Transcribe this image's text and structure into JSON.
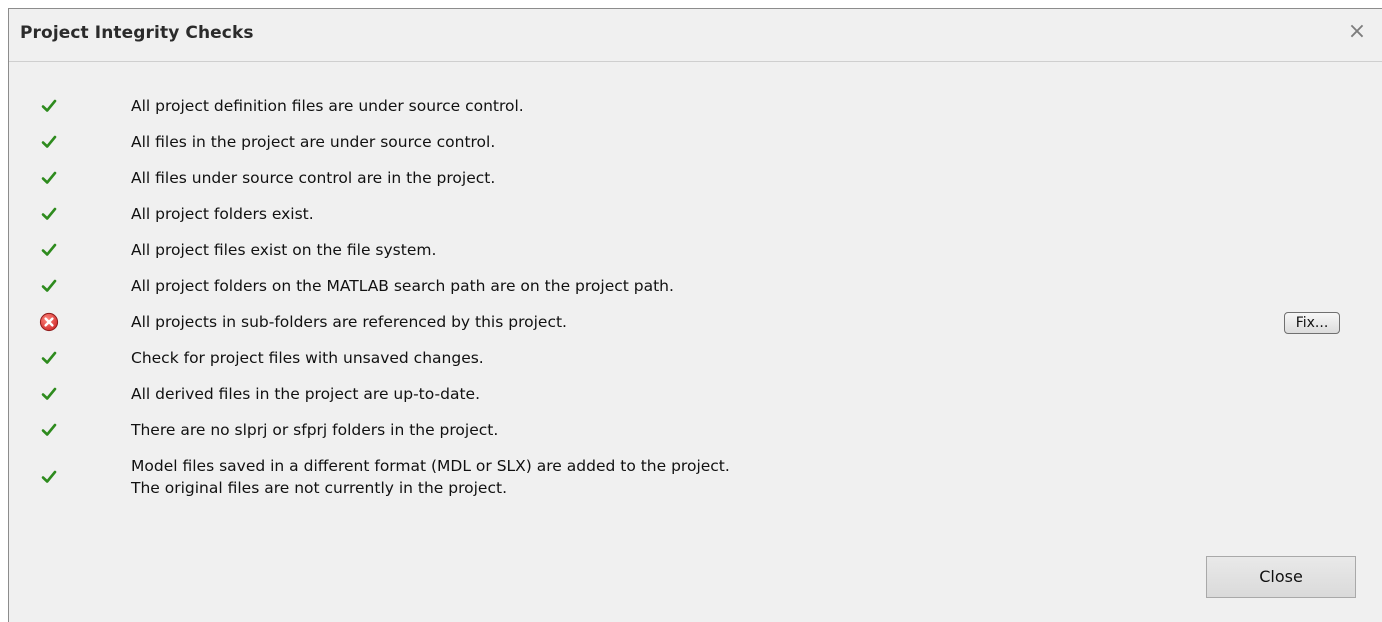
{
  "dialog": {
    "title": "Project Integrity Checks",
    "close_icon": "×",
    "close_label": "Close",
    "fix_label": "Fix..."
  },
  "colors": {
    "pass": "#2e8b1e",
    "fail": "#d32f2f"
  },
  "checks": [
    {
      "status": "pass",
      "icon": "check-icon",
      "lines": [
        "All project definition files are under source control."
      ]
    },
    {
      "status": "pass",
      "icon": "check-icon",
      "lines": [
        "All files in the project are under source control."
      ]
    },
    {
      "status": "pass",
      "icon": "check-icon",
      "lines": [
        "All files under source control are in the project."
      ]
    },
    {
      "status": "pass",
      "icon": "check-icon",
      "lines": [
        "All project folders exist."
      ]
    },
    {
      "status": "pass",
      "icon": "check-icon",
      "lines": [
        "All project files exist on the file system."
      ]
    },
    {
      "status": "pass",
      "icon": "check-icon",
      "lines": [
        "All project folders on the MATLAB search path are on the project path."
      ]
    },
    {
      "status": "fail",
      "icon": "error-icon",
      "lines": [
        "All projects in sub-folders are referenced by this project."
      ],
      "has_fix": true
    },
    {
      "status": "pass",
      "icon": "check-icon",
      "lines": [
        "Check for project files with unsaved changes."
      ]
    },
    {
      "status": "pass",
      "icon": "check-icon",
      "lines": [
        "All derived files in the project are up-to-date."
      ]
    },
    {
      "status": "pass",
      "icon": "check-icon",
      "lines": [
        "There are no slprj or sfprj folders in the project."
      ]
    },
    {
      "status": "pass",
      "icon": "check-icon",
      "lines": [
        "Model files saved in a different format (MDL or SLX) are added to the project.",
        "The original files are not currently in the project."
      ]
    }
  ]
}
